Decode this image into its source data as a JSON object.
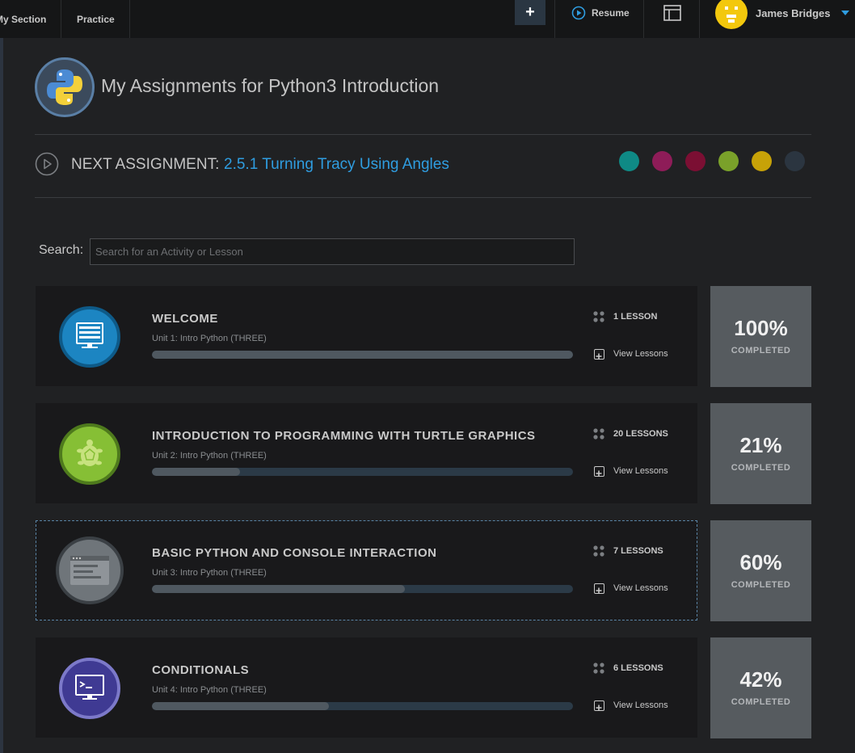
{
  "nav": {
    "my_section": "My Section",
    "practice": "Practice",
    "add_label": "+",
    "resume": "Resume",
    "user_name": "James Bridges"
  },
  "page": {
    "title": "My Assignments for Python3 Introduction",
    "next_label": "NEXT ASSIGNMENT:",
    "next_link": "2.5.1 Turning Tracy Using Angles",
    "theme_swatches": [
      "#0f8a85",
      "#8e1c58",
      "#7b0f33",
      "#7aa12a",
      "#c7a208",
      "#2b3540"
    ]
  },
  "search": {
    "label": "Search:",
    "placeholder": "Search for an Activity or Lesson",
    "value": ""
  },
  "units": [
    {
      "title": "WELCOME",
      "subtitle": "Unit 1: Intro Python (THREE)",
      "lessons": "1 LESSON",
      "view": "View Lessons",
      "percent": "100%",
      "percent_label": "COMPLETED",
      "progress": 1.0,
      "icon": "monitor-icon"
    },
    {
      "title": "INTRODUCTION TO PROGRAMMING WITH TURTLE GRAPHICS",
      "subtitle": "Unit 2: Intro Python (THREE)",
      "lessons": "20 LESSONS",
      "view": "View Lessons",
      "percent": "21%",
      "percent_label": "COMPLETED",
      "progress": 0.21,
      "icon": "turtle-icon"
    },
    {
      "title": "BASIC PYTHON AND CONSOLE INTERACTION",
      "subtitle": "Unit 3: Intro Python (THREE)",
      "lessons": "7 LESSONS",
      "view": "View Lessons",
      "percent": "60%",
      "percent_label": "COMPLETED",
      "progress": 0.6,
      "icon": "console-window-icon"
    },
    {
      "title": "CONDITIONALS",
      "subtitle": "Unit 4: Intro Python (THREE)",
      "lessons": "6 LESSONS",
      "view": "View Lessons",
      "percent": "42%",
      "percent_label": "COMPLETED",
      "progress": 0.42,
      "icon": "terminal-icon"
    }
  ]
}
